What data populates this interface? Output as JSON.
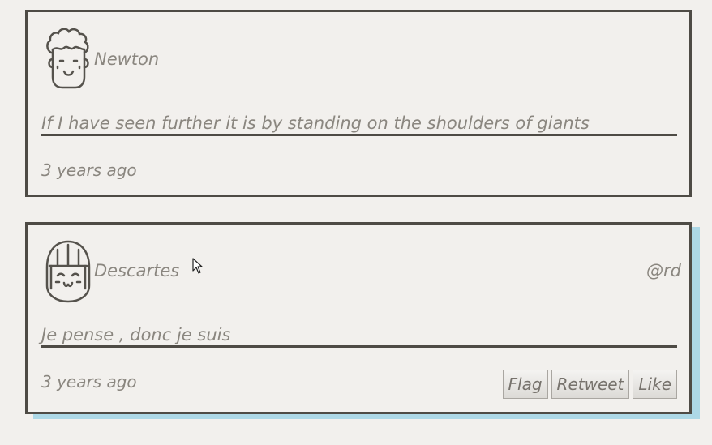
{
  "tweets": [
    {
      "author": "Newton",
      "handle": "",
      "text": "If I have seen further it is by standing on the shoulders of giants",
      "time": "3 years ago",
      "avatar_icon": "curly-hair-avatar-icon"
    },
    {
      "author": "Descartes",
      "handle": "@rd",
      "text": "Je pense , donc je suis",
      "time": "3 years ago",
      "avatar_icon": "bob-hair-avatar-icon",
      "actions": {
        "flag": "Flag",
        "retweet": "Retweet",
        "like": "Like"
      }
    }
  ],
  "colors": {
    "border": "#4e4b45",
    "text": "#8a867f",
    "highlight_shadow": "#add8e6",
    "background": "#f2f0ed"
  }
}
